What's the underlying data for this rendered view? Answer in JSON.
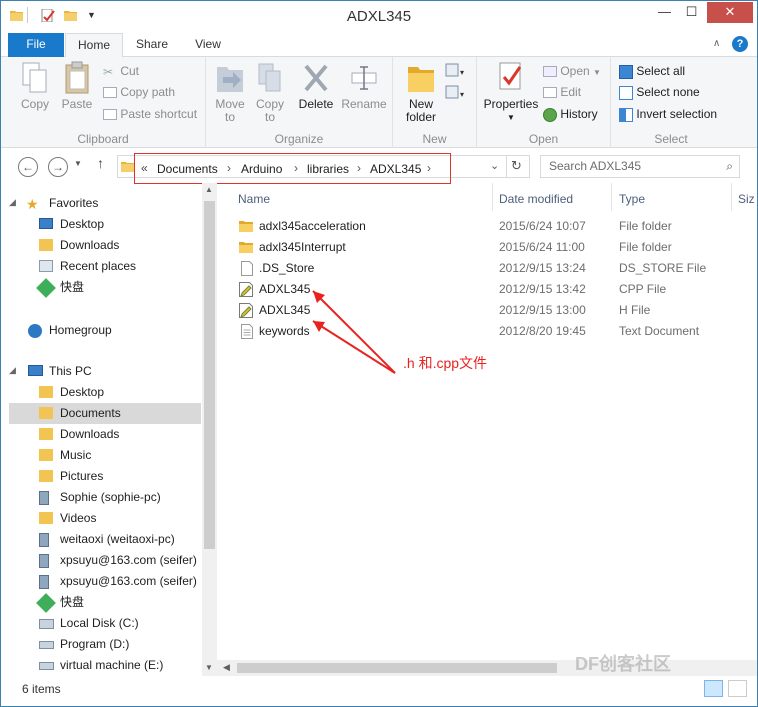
{
  "window": {
    "title": "ADXL345",
    "minimize": "—",
    "maximize": "☐",
    "close": "✕"
  },
  "ribbon_tabs": [
    {
      "label": "File"
    },
    {
      "label": "Home"
    },
    {
      "label": "Share"
    },
    {
      "label": "View"
    }
  ],
  "ribbon": {
    "clipboard": {
      "copy": "Copy",
      "paste": "Paste",
      "cut": "Cut",
      "copy_path": "Copy path",
      "paste_shortcut": "Paste shortcut",
      "label": "Clipboard"
    },
    "organize": {
      "move_to": "Move",
      "move_to2": "to",
      "copy_to": "Copy",
      "copy_to2": "to",
      "delete": "Delete",
      "rename": "Rename",
      "label": "Organize"
    },
    "new": {
      "new_folder": "New",
      "new_folder2": "folder",
      "label": "New"
    },
    "open": {
      "properties": "Properties",
      "open": "Open",
      "edit": "Edit",
      "history": "History",
      "label": "Open"
    },
    "select": {
      "select_all": "Select all",
      "select_none": "Select none",
      "invert": "Invert selection",
      "label": "Select"
    }
  },
  "navbar": {
    "breadcrumb": [
      {
        "label": "Documents"
      },
      {
        "label": "Arduino"
      },
      {
        "label": "libraries"
      },
      {
        "label": "ADXL345"
      }
    ],
    "overflow": "«",
    "search_placeholder": "Search ADXL345"
  },
  "nav_pane": {
    "favorites": {
      "label": "Favorites",
      "items": [
        {
          "label": "Desktop"
        },
        {
          "label": "Downloads"
        },
        {
          "label": "Recent places"
        },
        {
          "label": "快盘"
        }
      ]
    },
    "homegroup": {
      "label": "Homegroup"
    },
    "thispc": {
      "label": "This PC",
      "items": [
        {
          "label": "Desktop"
        },
        {
          "label": "Documents"
        },
        {
          "label": "Downloads"
        },
        {
          "label": "Music"
        },
        {
          "label": "Pictures"
        },
        {
          "label": "Sophie (sophie-pc)"
        },
        {
          "label": "Videos"
        },
        {
          "label": "weitaoxi (weitaoxi-pc)"
        },
        {
          "label": "xpsuyu@163.com (seifer)"
        },
        {
          "label": "xpsuyu@163.com (seifer)"
        },
        {
          "label": "快盘"
        },
        {
          "label": "Local Disk (C:)"
        },
        {
          "label": "Program (D:)"
        },
        {
          "label": "virtual machine (E:)"
        }
      ]
    }
  },
  "file_list": {
    "columns": {
      "name": "Name",
      "date": "Date modified",
      "type": "Type",
      "size": "Siz"
    },
    "rows": [
      {
        "name": "adxl345acceleration",
        "date": "2015/6/24 10:07",
        "type": "File folder",
        "icon": "folder-icon"
      },
      {
        "name": "adxl345Interrupt",
        "date": "2015/6/24 11:00",
        "type": "File folder",
        "icon": "folder-icon"
      },
      {
        "name": ".DS_Store",
        "date": "2012/9/15 13:24",
        "type": "DS_STORE File",
        "icon": "file-icon"
      },
      {
        "name": "ADXL345",
        "date": "2012/9/15 13:42",
        "type": "CPP File",
        "icon": "cpp-file-icon"
      },
      {
        "name": "ADXL345",
        "date": "2012/9/15 13:00",
        "type": "H File",
        "icon": "h-file-icon"
      },
      {
        "name": "keywords",
        "date": "2012/8/20 19:45",
        "type": "Text Document",
        "icon": "text-file-icon"
      }
    ]
  },
  "annotation": {
    "text": ".h 和.cpp文件",
    "color": "#e8231f"
  },
  "status": {
    "item_count": "6 items"
  },
  "watermark": "DF创客社区",
  "colors": {
    "accent": "#1979ca",
    "close": "#c7504b",
    "selection": "#cce8ff"
  }
}
